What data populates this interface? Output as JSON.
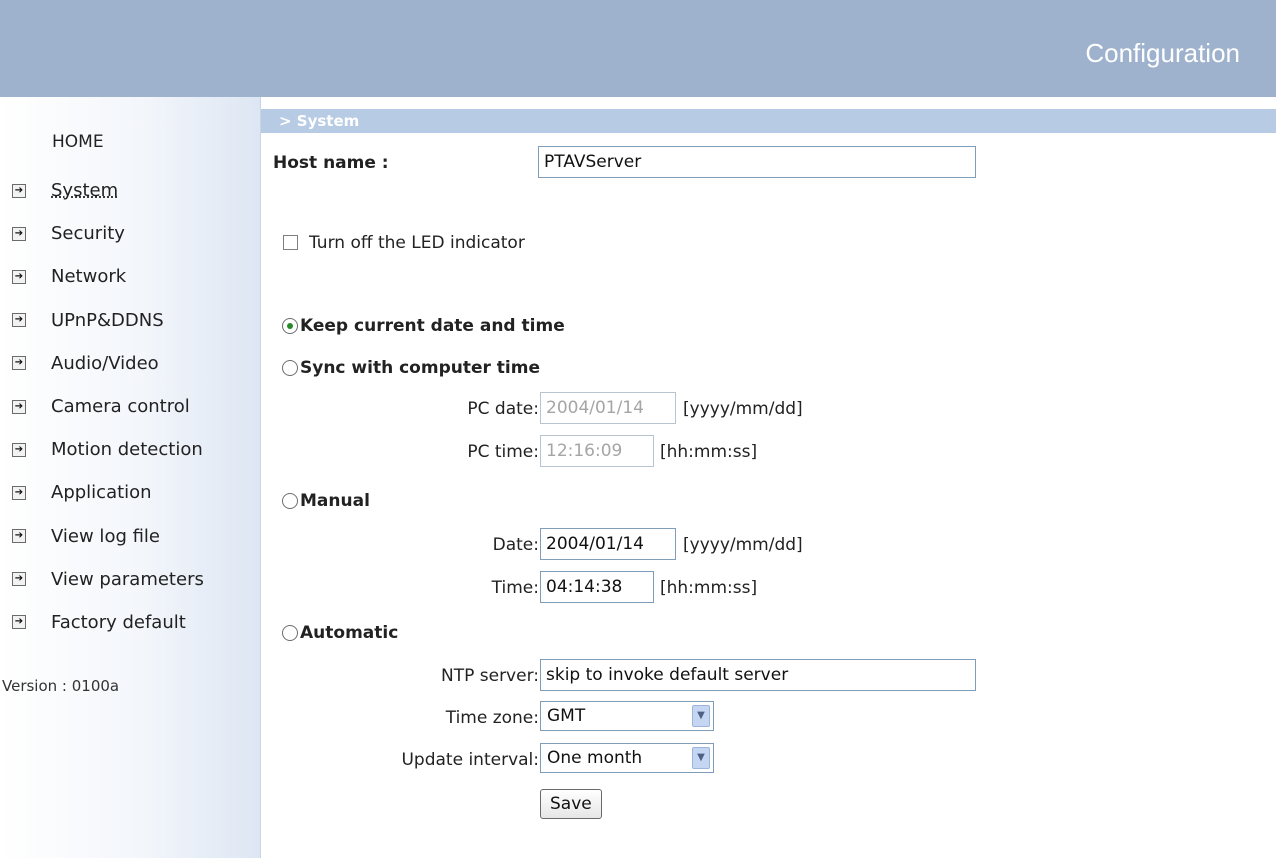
{
  "header": {
    "title": "Configuration"
  },
  "sidebar": {
    "home": "HOME",
    "items": [
      {
        "label": "System"
      },
      {
        "label": "Security"
      },
      {
        "label": "Network"
      },
      {
        "label": "UPnP&DDNS"
      },
      {
        "label": "Audio/Video"
      },
      {
        "label": "Camera control"
      },
      {
        "label": "Motion detection"
      },
      {
        "label": "Application"
      },
      {
        "label": "View log file"
      },
      {
        "label": "View parameters"
      },
      {
        "label": "Factory default"
      }
    ],
    "version": "Version : 0100a"
  },
  "section": {
    "title": "> System"
  },
  "form": {
    "host_label": "Host name :",
    "host_value": "PTAVServer",
    "led_label": "Turn off the LED indicator",
    "keep_label": "Keep current date and time",
    "sync_label": "Sync with computer time",
    "pc_date_label": "PC date:",
    "pc_date_value": "2004/01/14",
    "pc_date_fmt": "[yyyy/mm/dd]",
    "pc_time_label": "PC time:",
    "pc_time_value": "12:16:09",
    "pc_time_fmt": "[hh:mm:ss]",
    "manual_label": "Manual",
    "date_label": "Date:",
    "date_value": "2004/01/14",
    "date_fmt": "[yyyy/mm/dd]",
    "time_label": "Time:",
    "time_value": "04:14:38",
    "time_fmt": "[hh:mm:ss]",
    "auto_label": "Automatic",
    "ntp_label": "NTP server:",
    "ntp_value": "skip to invoke default server",
    "tz_label": "Time zone:",
    "tz_value": "GMT",
    "interval_label": "Update interval:",
    "interval_value": "One month",
    "save_label": "Save"
  }
}
